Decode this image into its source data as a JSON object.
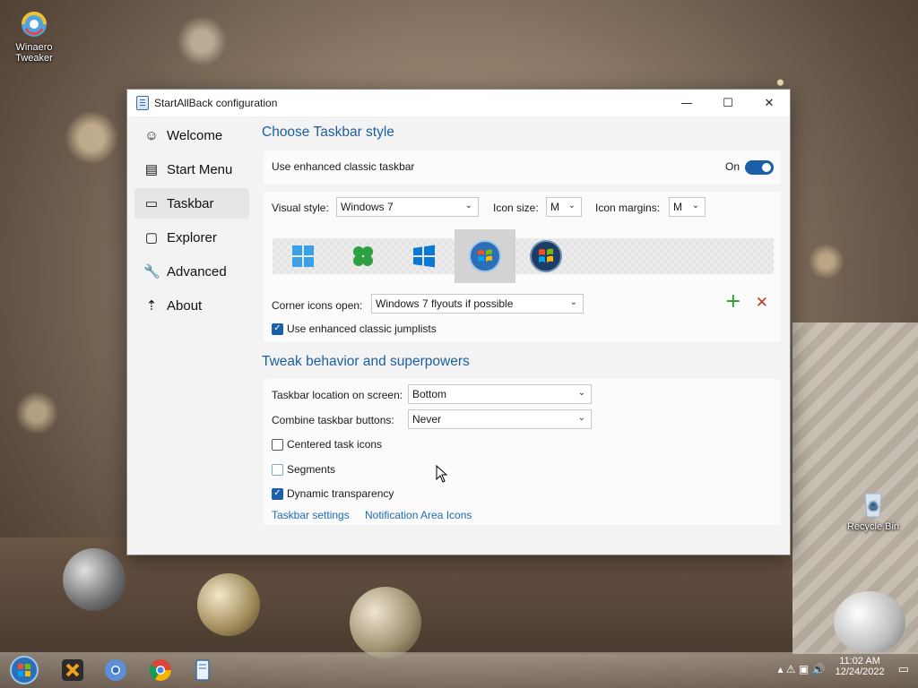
{
  "desktop": {
    "icons": [
      {
        "label": "Winaero Tweaker"
      },
      {
        "label": "Recycle Bin"
      }
    ]
  },
  "window": {
    "title": "StartAllBack configuration",
    "buttons": {
      "minimize": "—",
      "maximize": "☐",
      "close": "✕"
    }
  },
  "nav": {
    "items": [
      {
        "label": "Welcome",
        "icon": "smile-icon"
      },
      {
        "label": "Start Menu",
        "icon": "start-menu-icon"
      },
      {
        "label": "Taskbar",
        "icon": "taskbar-icon",
        "active": true
      },
      {
        "label": "Explorer",
        "icon": "folder-icon"
      },
      {
        "label": "Advanced",
        "icon": "wrench-icon"
      },
      {
        "label": "About",
        "icon": "info-icon"
      }
    ]
  },
  "taskbar_style": {
    "heading": "Choose Taskbar style",
    "enhanced_label": "Use enhanced classic taskbar",
    "enhanced_state": "On",
    "visual_style_label": "Visual style:",
    "visual_style_value": "Windows 7",
    "icon_size_label": "Icon size:",
    "icon_size_value": "M",
    "icon_margins_label": "Icon margins:",
    "icon_margins_value": "M",
    "styles": [
      "windows-11-logo",
      "clover-logo",
      "windows-10-logo",
      "windows-7-orb",
      "windows-vista-orb"
    ],
    "selected_style_index": 3,
    "corner_label": "Corner icons open:",
    "corner_value": "Windows 7 flyouts if possible",
    "jumplists_label": "Use enhanced classic jumplists",
    "jumplists_checked": true
  },
  "tweak": {
    "heading": "Tweak behavior and superpowers",
    "location_label": "Taskbar location on screen:",
    "location_value": "Bottom",
    "combine_label": "Combine taskbar buttons:",
    "combine_value": "Never",
    "centered_label": "Centered task icons",
    "centered_checked": false,
    "segments_label": "Segments",
    "segments_checked": false,
    "transparency_label": "Dynamic transparency",
    "transparency_checked": true,
    "links": [
      "Taskbar settings",
      "Notification Area Icons"
    ]
  },
  "tray": {
    "time": "11:02 AM",
    "date": "12/24/2022"
  },
  "colors": {
    "accent": "#1a5fa8",
    "heading": "#1b5f9e",
    "add": "#2e9a2e",
    "remove": "#c0392b"
  }
}
